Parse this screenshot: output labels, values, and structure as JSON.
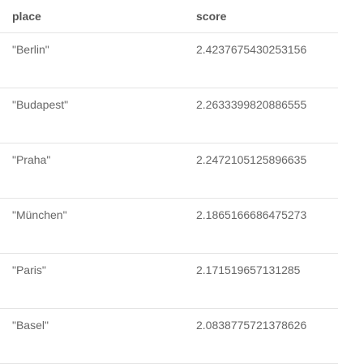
{
  "table": {
    "columns": [
      "place",
      "score"
    ],
    "rows": [
      {
        "place": "\"Berlin\"",
        "score": "2.4237675430253156"
      },
      {
        "place": "\"Budapest\"",
        "score": "2.2633399820886555"
      },
      {
        "place": "\"Praha\"",
        "score": "2.2472105125896635"
      },
      {
        "place": "\"München\"",
        "score": "2.1865166686475273"
      },
      {
        "place": "\"Paris\"",
        "score": "2.171519657131285"
      },
      {
        "place": "\"Basel\"",
        "score": "2.0838775721378626"
      }
    ]
  }
}
